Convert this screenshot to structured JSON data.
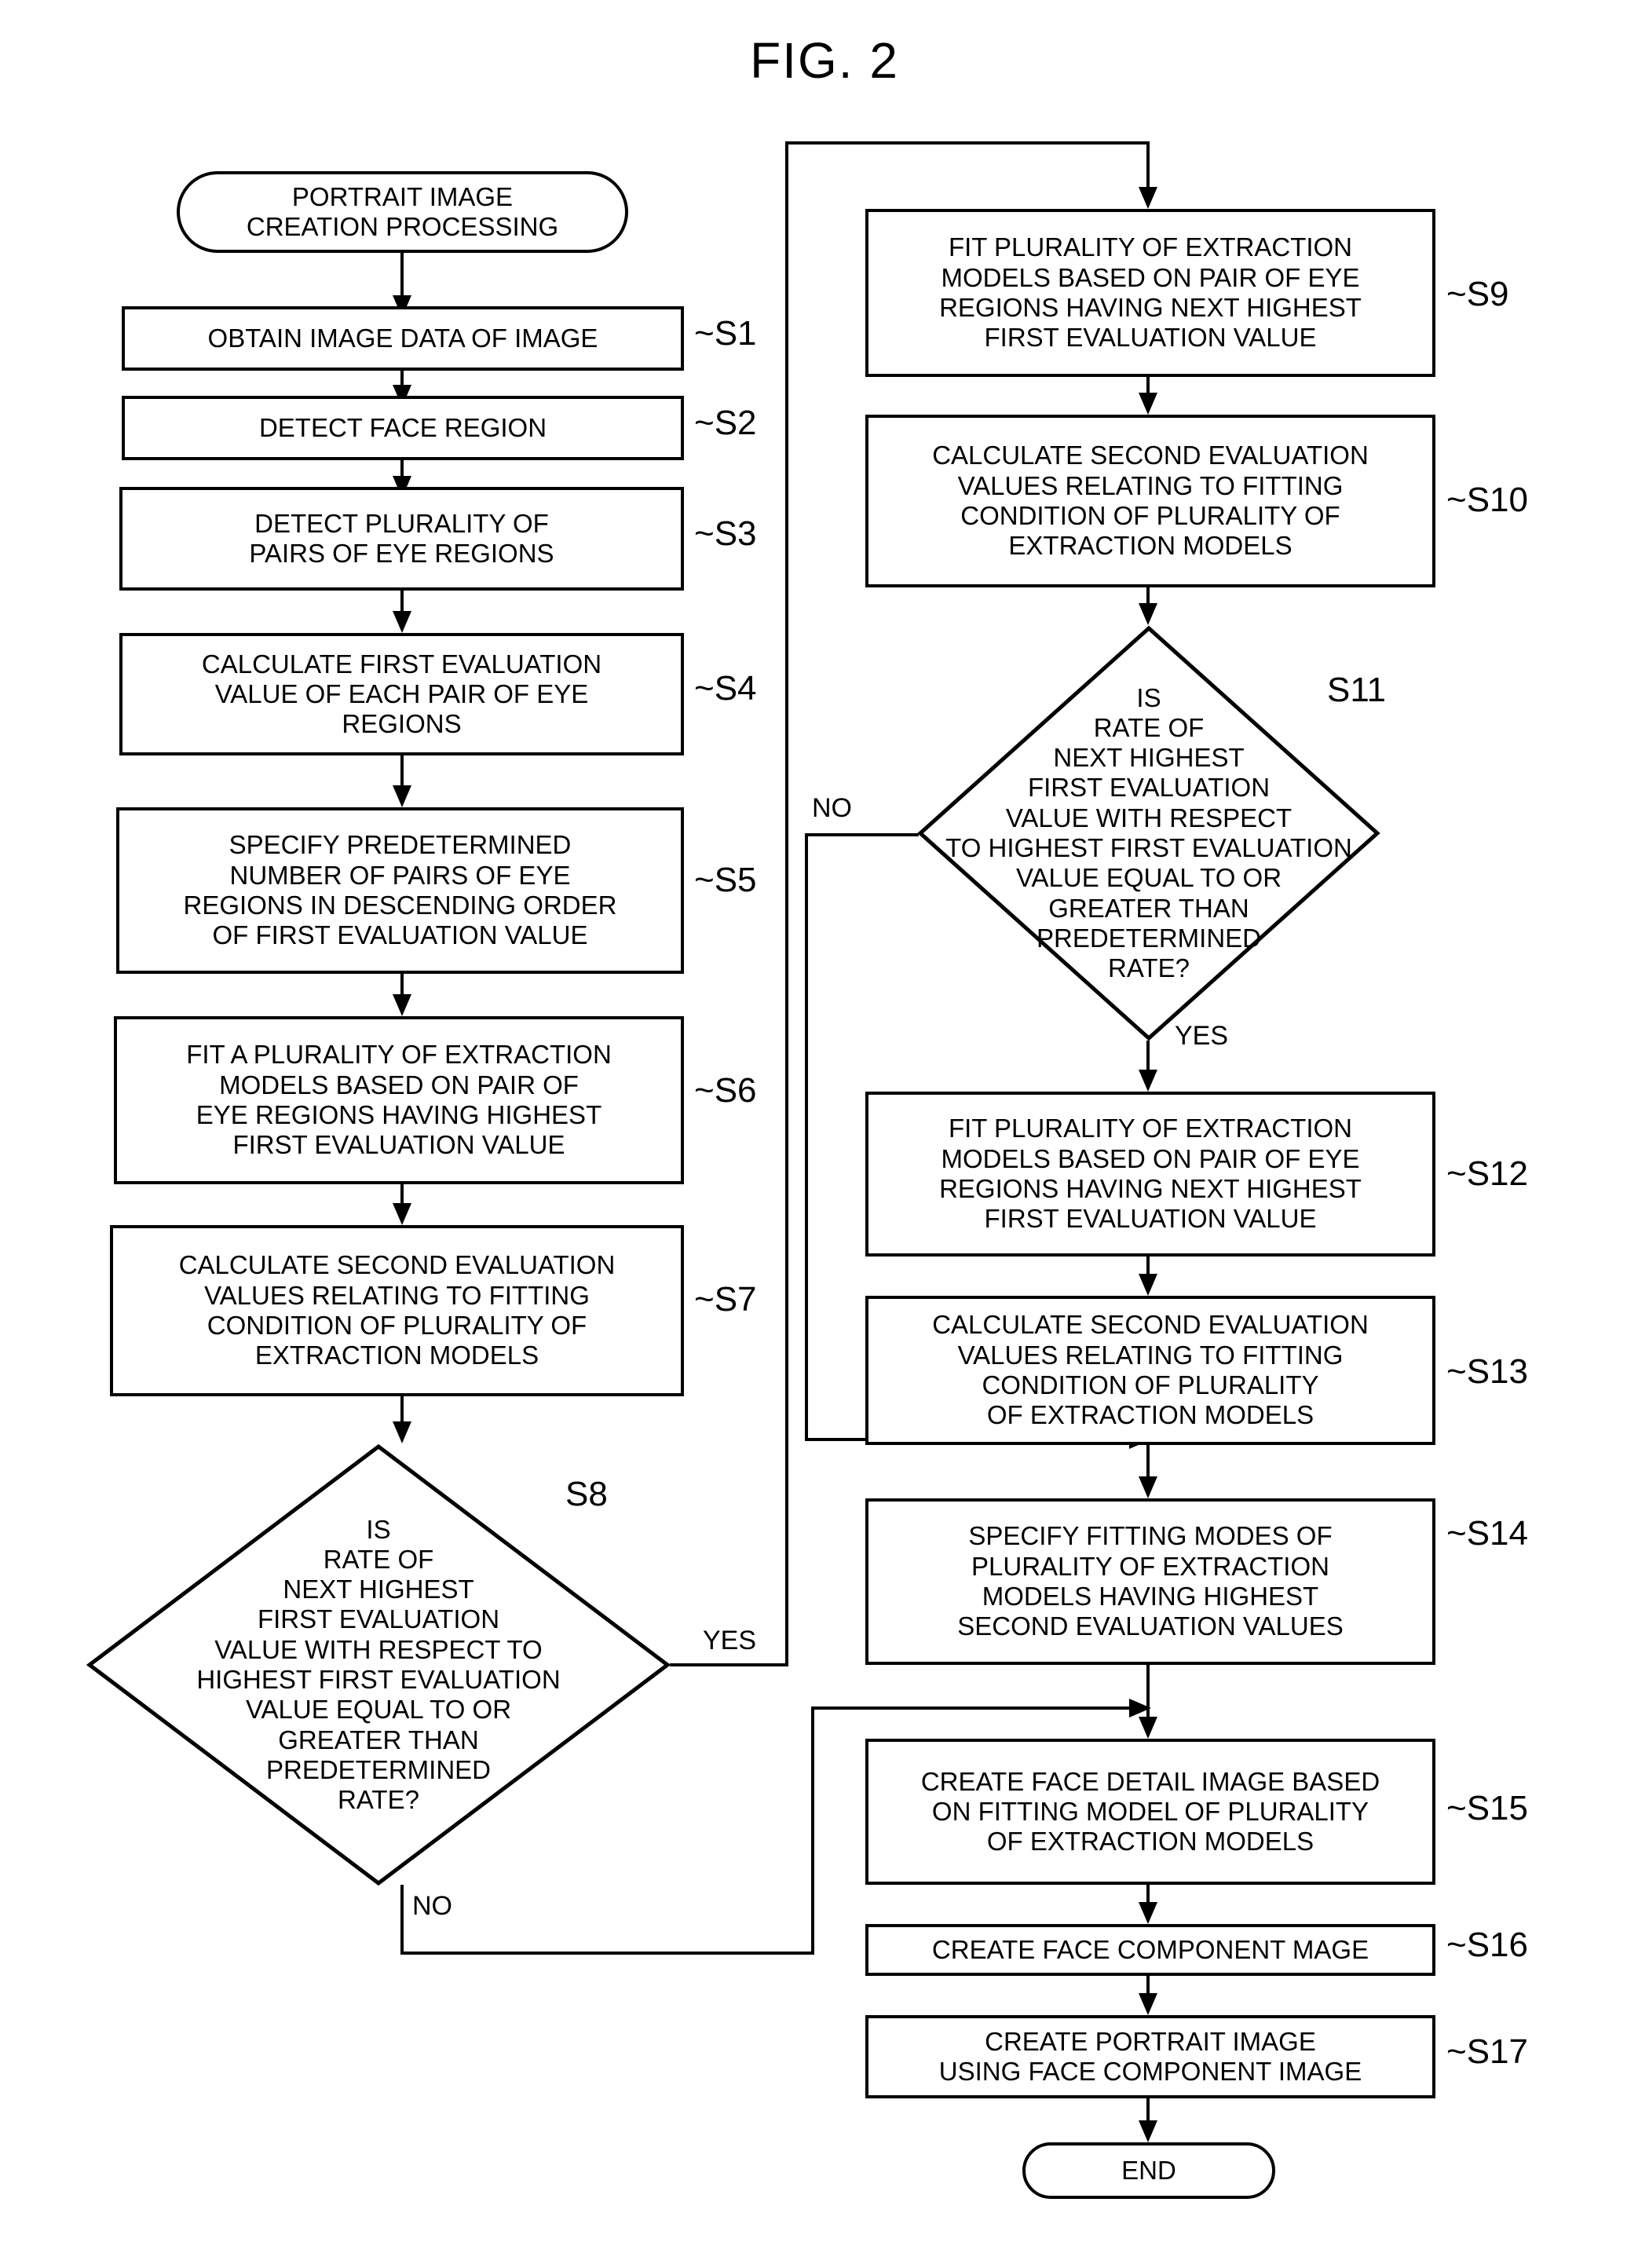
{
  "figure": {
    "title": "FIG. 2"
  },
  "nodes": {
    "start": {
      "label": "PORTRAIT IMAGE\nCREATION PROCESSING",
      "shape": "terminal"
    },
    "s1": {
      "ref": "S1",
      "label": "OBTAIN IMAGE DATA OF IMAGE",
      "shape": "process"
    },
    "s2": {
      "ref": "S2",
      "label": "DETECT FACE REGION",
      "shape": "process"
    },
    "s3": {
      "ref": "S3",
      "label": "DETECT PLURALITY OF\nPAIRS OF EYE REGIONS",
      "shape": "process"
    },
    "s4": {
      "ref": "S4",
      "label": "CALCULATE FIRST EVALUATION\nVALUE OF EACH PAIR OF EYE\nREGIONS",
      "shape": "process"
    },
    "s5": {
      "ref": "S5",
      "label": "SPECIFY PREDETERMINED\nNUMBER OF PAIRS OF EYE\nREGIONS  IN DESCENDING ORDER\nOF FIRST EVALUATION VALUE",
      "shape": "process"
    },
    "s6": {
      "ref": "S6",
      "label": "FIT A PLURALITY OF EXTRACTION\nMODELS BASED ON PAIR OF\nEYE REGIONS HAVING HIGHEST\nFIRST EVALUATION VALUE",
      "shape": "process"
    },
    "s7": {
      "ref": "S7",
      "label": "CALCULATE SECOND EVALUATION\nVALUES RELATING TO FITTING\nCONDITION OF PLURALITY OF\nEXTRACTION MODELS",
      "shape": "process"
    },
    "s8": {
      "ref": "S8",
      "label": "IS\nRATE OF\nNEXT HIGHEST\nFIRST EVALUATION\nVALUE WITH RESPECT TO\nHIGHEST FIRST EVALUATION\nVALUE EQUAL TO OR\nGREATER THAN\nPREDETERMINED\nRATE?",
      "shape": "decision",
      "yes_label": "YES",
      "no_label": "NO"
    },
    "s9": {
      "ref": "S9",
      "label": "FIT PLURALITY OF EXTRACTION\nMODELS BASED ON PAIR OF EYE\nREGIONS HAVING NEXT HIGHEST\nFIRST EVALUATION  VALUE",
      "shape": "process"
    },
    "s10": {
      "ref": "S10",
      "label": "CALCULATE SECOND EVALUATION\nVALUES RELATING TO FITTING\nCONDITION OF PLURALITY OF\nEXTRACTION MODELS",
      "shape": "process"
    },
    "s11": {
      "ref": "S11",
      "label": "IS\nRATE OF\nNEXT HIGHEST\nFIRST EVALUATION\nVALUE WITH  RESPECT\nTO HIGHEST FIRST EVALUATION\nVALUE EQUAL TO OR\nGREATER THAN\nPREDETERMINED\nRATE?",
      "shape": "decision",
      "yes_label": "YES",
      "no_label": "NO"
    },
    "s12": {
      "ref": "S12",
      "label": "FIT PLURALITY OF EXTRACTION\nMODELS BASED ON PAIR OF EYE\nREGIONS HAVING NEXT HIGHEST\nFIRST EVALUATION VALUE",
      "shape": "process"
    },
    "s13": {
      "ref": "S13",
      "label": "CALCULATE SECOND EVALUATION\nVALUES RELATING TO FITTING\nCONDITION OF PLURALITY\nOF EXTRACTION MODELS",
      "shape": "process"
    },
    "s14": {
      "ref": "S14",
      "label": "SPECIFY FITTING MODES OF\nPLURALITY OF EXTRACTION\nMODELS HAVING HIGHEST\nSECOND EVALUATION VALUES",
      "shape": "process"
    },
    "s15": {
      "ref": "S15",
      "label": "CREATE FACE DETAIL IMAGE BASED\nON FITTING MODEL OF PLURALITY\nOF EXTRACTION MODELS",
      "shape": "process"
    },
    "s16": {
      "ref": "S16",
      "label": "CREATE FACE COMPONENT MAGE",
      "shape": "process"
    },
    "s17": {
      "ref": "S17",
      "label": "CREATE PORTRAIT IMAGE\nUSING FACE COMPONENT IMAGE",
      "shape": "process"
    },
    "end": {
      "label": "END",
      "shape": "terminal"
    }
  },
  "colors": {
    "stroke": "#000000",
    "background": "#ffffff",
    "text": "#000000"
  }
}
